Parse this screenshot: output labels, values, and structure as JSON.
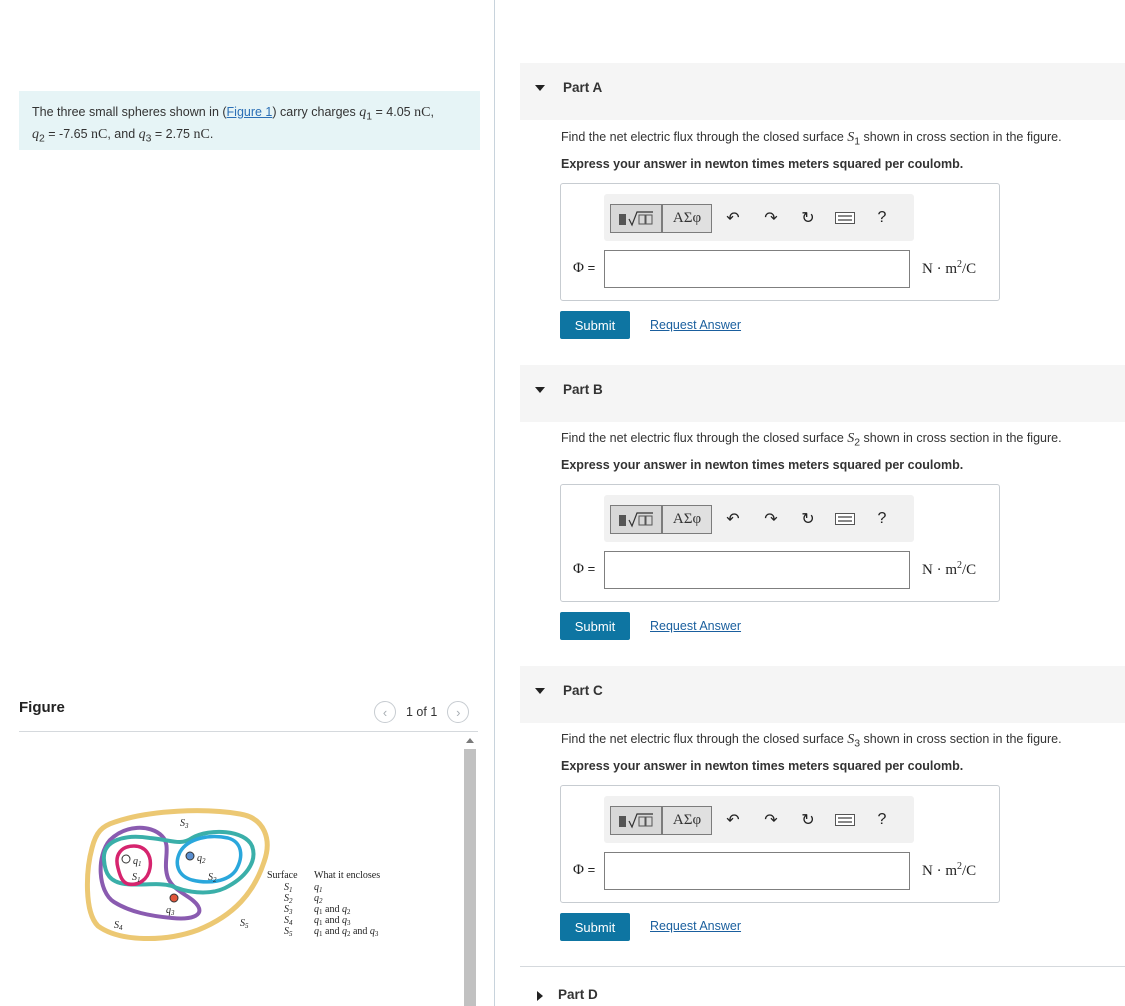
{
  "problem": {
    "prefix": "The three small spheres shown in (",
    "figure_link": "Figure 1",
    "suffix": ") carry charges ",
    "q1_sym": "q",
    "q1_sub": "1",
    "q1_eq": " = 4.05 ",
    "unit_nc": "nC",
    "comma": ", ",
    "q2_sym": "q",
    "q2_sub": "2",
    "q2_eq": " = -7.65 ",
    "and_text": ", and ",
    "q3_sym": "q",
    "q3_sub": "3",
    "q3_eq": " = 2.75 ",
    "period": "."
  },
  "figure": {
    "title": "Figure",
    "pager_label": "1 of 1",
    "prev_icon": "chevron-left-icon",
    "next_icon": "chevron-right-icon",
    "table_header_surface": "Surface",
    "table_header_encloses": "What it encloses",
    "surface_labels": [
      "S1",
      "S2",
      "S3",
      "S4",
      "S5"
    ],
    "rows": [
      {
        "surface": "S",
        "sub": "1",
        "encloses": "q1"
      },
      {
        "surface": "S",
        "sub": "2",
        "encloses": "q2"
      },
      {
        "surface": "S",
        "sub": "3",
        "encloses": "q1 and q2"
      },
      {
        "surface": "S",
        "sub": "4",
        "encloses": "q1 and q3"
      },
      {
        "surface": "S",
        "sub": "5",
        "encloses": "q1 and q2 and q3"
      }
    ],
    "colors": {
      "S1": "#d6246e",
      "S2": "#2aa7dc",
      "S3": "#3aafa9",
      "S4": "#8a5bb0",
      "S5": "#ecc873",
      "q1": "#ffffff",
      "q2": "#5b8fd0",
      "q3": "#e0553a"
    }
  },
  "parts": [
    {
      "title": "Part A",
      "question_prefix": "Find the net electric flux through the closed surface ",
      "surface_sym": "S",
      "surface_sub": "1",
      "question_suffix": " shown in cross section in the figure.",
      "instruction": "Express your answer in newton times meters squared per coulomb.",
      "phi_symbol": "Φ",
      "phi_eq": " =",
      "input_value": "",
      "units_pre": "N · m",
      "units_sup": "2",
      "units_post": "/C",
      "submit": "Submit",
      "request": "Request Answer"
    },
    {
      "title": "Part B",
      "question_prefix": "Find the net electric flux through the closed surface ",
      "surface_sym": "S",
      "surface_sub": "2",
      "question_suffix": " shown in cross section in the figure.",
      "instruction": "Express your answer in newton times meters squared per coulomb.",
      "phi_symbol": "Φ",
      "phi_eq": " =",
      "input_value": "",
      "units_pre": "N · m",
      "units_sup": "2",
      "units_post": "/C",
      "submit": "Submit",
      "request": "Request Answer"
    },
    {
      "title": "Part C",
      "question_prefix": "Find the net electric flux through the closed surface ",
      "surface_sym": "S",
      "surface_sub": "3",
      "question_suffix": " shown in cross section in the figure.",
      "instruction": "Express your answer in newton times meters squared per coulomb.",
      "phi_symbol": "Φ",
      "phi_eq": " =",
      "input_value": "",
      "units_pre": "N · m",
      "units_sup": "2",
      "units_post": "/C",
      "submit": "Submit",
      "request": "Request Answer"
    },
    {
      "title": "Part D"
    }
  ],
  "toolbar": {
    "greek_label": "ΑΣφ",
    "help_label": "?",
    "icons": [
      "templates-icon",
      "greek-symbols-icon",
      "undo-icon",
      "redo-icon",
      "reset-icon",
      "keyboard-icon",
      "help-icon"
    ]
  }
}
